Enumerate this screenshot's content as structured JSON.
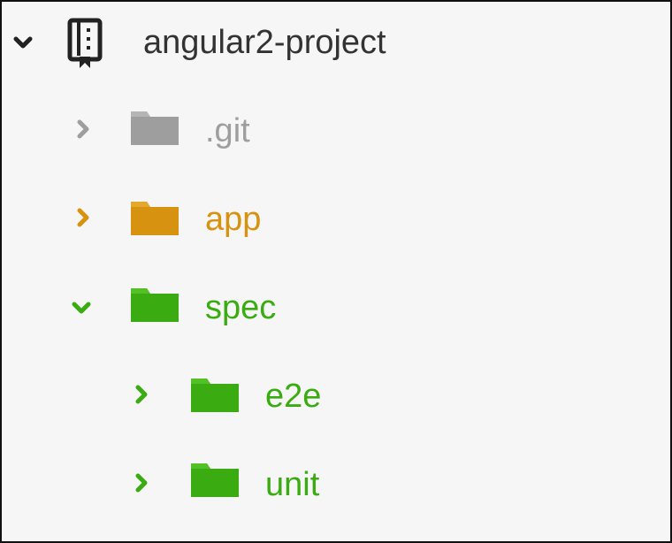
{
  "tree": {
    "root": {
      "label": "angular2-project",
      "expanded": true,
      "icon": "repo-book-icon"
    },
    "items": [
      {
        "label": ".git",
        "expanded": false,
        "icon": "folder-icon",
        "color": "#9e9e9e",
        "depth": 1
      },
      {
        "label": "app",
        "expanded": false,
        "icon": "folder-icon",
        "color": "#d7930f",
        "depth": 1
      },
      {
        "label": "spec",
        "expanded": true,
        "icon": "folder-icon",
        "color": "#3bab12",
        "depth": 1
      },
      {
        "label": "e2e",
        "expanded": false,
        "icon": "folder-icon",
        "color": "#3bab12",
        "depth": 2
      },
      {
        "label": "unit",
        "expanded": false,
        "icon": "folder-icon",
        "color": "#3bab12",
        "depth": 2
      }
    ]
  }
}
